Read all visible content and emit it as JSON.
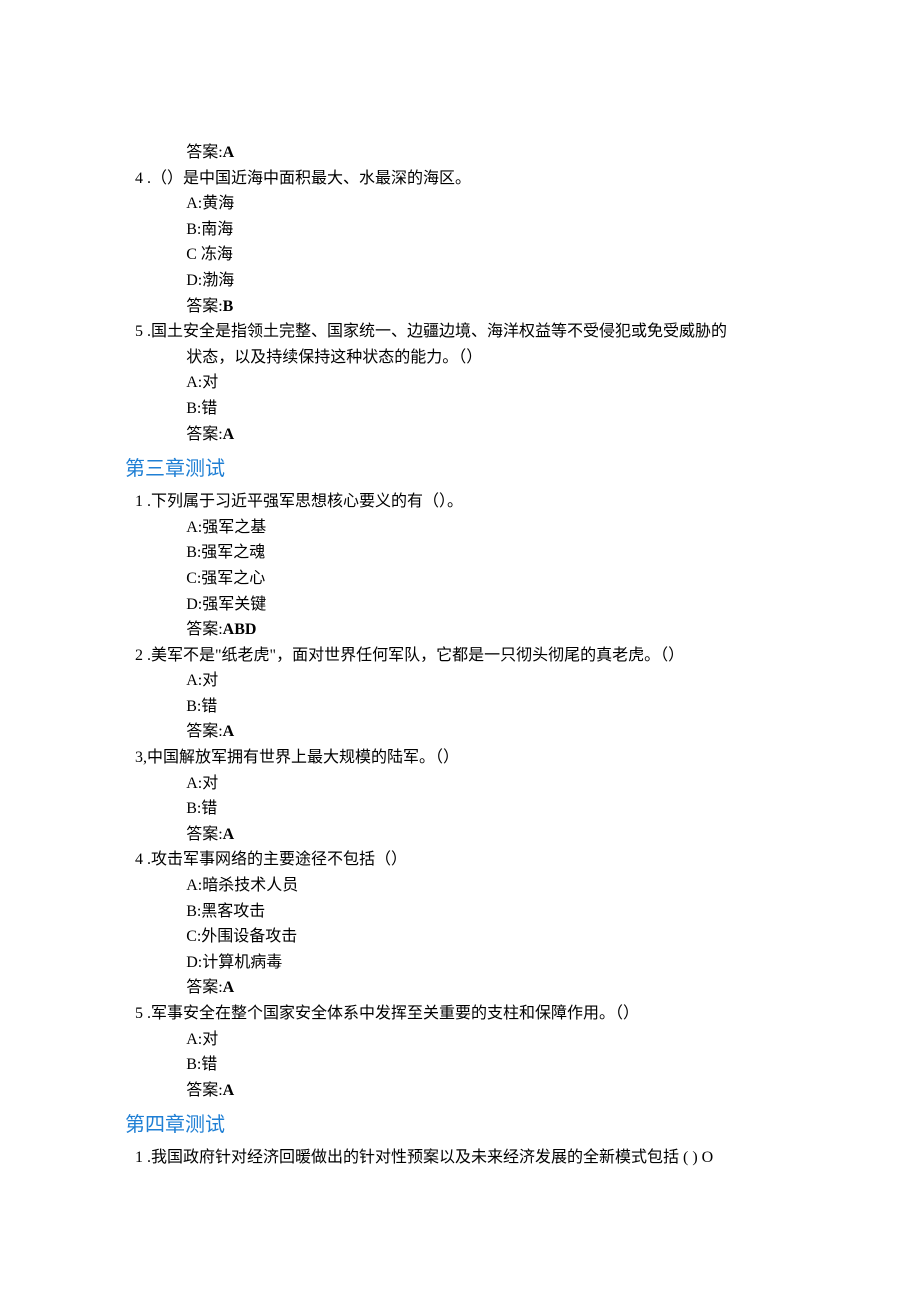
{
  "labels": {
    "answer": "答案:"
  },
  "sections": [
    {
      "title": null,
      "questions": [
        {
          "num": "",
          "stem": "",
          "stem2": "",
          "opts": [],
          "ans": "A",
          "pre_answer_only": true
        },
        {
          "num": "4",
          "stem": ".（）是中国近海中面积最大、水最深的海区。",
          "opts": [
            "A:黄海",
            "B:南海",
            "C 冻海",
            "D:渤海"
          ],
          "ans": "B"
        },
        {
          "num": "5",
          "stem": ".国土安全是指领土完整、国家统一、边疆边境、海洋权益等不受侵犯或免受威胁的",
          "stem2": "状态，以及持续保持这种状态的能力。（）",
          "opts": [
            "A:对",
            "B:错"
          ],
          "ans": "A"
        }
      ]
    },
    {
      "title": "第三章测试",
      "questions": [
        {
          "num": "1",
          "stem": ".下列属于习近平强军思想核心要义的有（）。",
          "opts": [
            "A:强军之基",
            "B:强军之魂",
            "C:强军之心",
            "D:强军关键"
          ],
          "ans": "ABD"
        },
        {
          "num": "2",
          "stem": ".美军不是\"纸老虎\"，面对世界任何军队，它都是一只彻头彻尾的真老虎。（）",
          "opts": [
            "A:对",
            "B:错"
          ],
          "ans": "A"
        },
        {
          "num": "3,",
          "stem": "中国解放军拥有世界上最大规模的陆军。（）",
          "flat": true,
          "opts": [
            "A:对",
            "B:错"
          ],
          "ans": "A"
        },
        {
          "num": "4",
          "stem": ".攻击军事网络的主要途径不包括（）",
          "opts": [
            "A:暗杀技术人员",
            "B:黑客攻击",
            "C:外围设备攻击",
            "D:计算机病毒"
          ],
          "ans": "A"
        },
        {
          "num": "5",
          "stem": ".军事安全在整个国家安全体系中发挥至关重要的支柱和保障作用。（）",
          "opts": [
            "A:对",
            "B:错"
          ],
          "ans": "A"
        }
      ]
    },
    {
      "title": "第四章测试",
      "questions": [
        {
          "num": "1",
          "stem": ".我国政府针对经济回暖做出的针对性预案以及未来经济发展的全新模式包括 ( ) O",
          "opts": [],
          "ans": null
        }
      ]
    }
  ]
}
